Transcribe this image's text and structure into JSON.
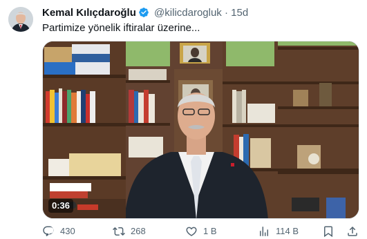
{
  "author": {
    "name": "Kemal Kılıçdaroğlu",
    "handle": "@kilicdarogluk",
    "separator": "·",
    "time": "15d",
    "verified": true
  },
  "tweet": {
    "text": "Partimize yönelik iftiralar üzerine..."
  },
  "video": {
    "duration": "0:36"
  },
  "actions": {
    "replies": "430",
    "retweets": "268",
    "likes": "1 B",
    "views": "114 B"
  },
  "colors": {
    "text_primary": "#0f1419",
    "text_secondary": "#536471",
    "verified_blue": "#1d9bf0"
  }
}
